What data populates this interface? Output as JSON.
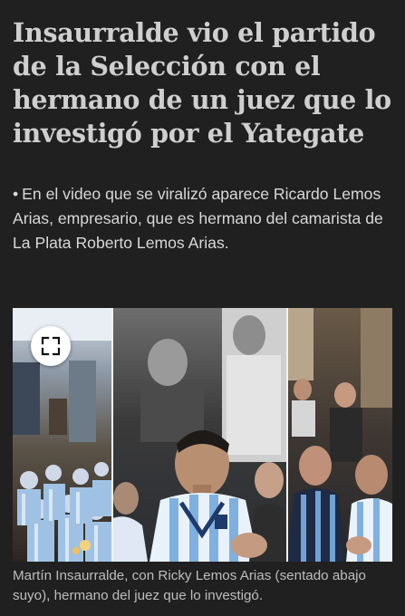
{
  "article": {
    "headline": "Insaurralde vio el partido de la Selección con el hermano de un juez que lo investigó por el Yategate",
    "summary_bullet": "•",
    "summary": "En el video que se viralizó aparece Ricardo Lemos Arias, empresario, que es hermano del camarista de La Plata Roberto Lemos Arias."
  },
  "media": {
    "expand_icon": "expand-icon",
    "caption": "Martín Insaurralde, con Ricky Lemos Arias (sentado abajo suyo), hermano del juez que lo investigó."
  },
  "colors": {
    "background": "#202020",
    "headline": "#cfcfcf",
    "summary": "#d8d8d8",
    "caption": "#bdbdbd"
  }
}
